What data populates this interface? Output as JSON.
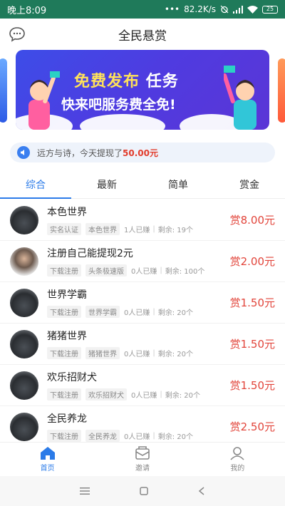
{
  "status_bar": {
    "time": "晚上8:09",
    "network": "82.2K/s",
    "battery": "25"
  },
  "header": {
    "title": "全民悬赏"
  },
  "banner": {
    "line1_highlight": "免费发布",
    "line1_rest": "任务",
    "line2": "快来吧服务费全免!"
  },
  "notice": {
    "text": "远方与诗，今天提现了",
    "amount": "50.00元"
  },
  "tabs": [
    {
      "label": "综合",
      "active": true
    },
    {
      "label": "最新",
      "active": false
    },
    {
      "label": "简单",
      "active": false
    },
    {
      "label": "赏金",
      "active": false
    }
  ],
  "tasks": [
    {
      "name": "本色世界",
      "tag1": "实名认证",
      "tag2": "本色世界",
      "earned": "1人已赚",
      "remaining": "剩余: 19个",
      "reward": "赏8.00元"
    },
    {
      "name": "注册自己能提现2元",
      "tag1": "下载注册",
      "tag2": "头条极速版",
      "earned": "0人已赚",
      "remaining": "剩余: 100个",
      "reward": "赏2.00元"
    },
    {
      "name": "世界学霸",
      "tag1": "下载注册",
      "tag2": "世界学霸",
      "earned": "0人已赚",
      "remaining": "剩余: 20个",
      "reward": "赏1.50元"
    },
    {
      "name": "猪猪世界",
      "tag1": "下载注册",
      "tag2": "猪猪世界",
      "earned": "0人已赚",
      "remaining": "剩余: 20个",
      "reward": "赏1.50元"
    },
    {
      "name": "欢乐招财犬",
      "tag1": "下载注册",
      "tag2": "欢乐招财犬",
      "earned": "0人已赚",
      "remaining": "剩余: 20个",
      "reward": "赏1.50元"
    },
    {
      "name": "全民养龙",
      "tag1": "下载注册",
      "tag2": "全民养龙",
      "earned": "0人已赚",
      "remaining": "剩余: 20个",
      "reward": "赏2.50元"
    }
  ],
  "bottom_nav": [
    {
      "label": "首页",
      "icon": "home-icon",
      "active": true
    },
    {
      "label": "邀请",
      "icon": "invite-icon",
      "active": false
    },
    {
      "label": "我的",
      "icon": "profile-icon",
      "active": false
    }
  ],
  "colors": {
    "status_bar": "#1f7a5a",
    "accent": "#2b7be8",
    "reward": "#e2443a",
    "banner": "#4f3be0"
  }
}
